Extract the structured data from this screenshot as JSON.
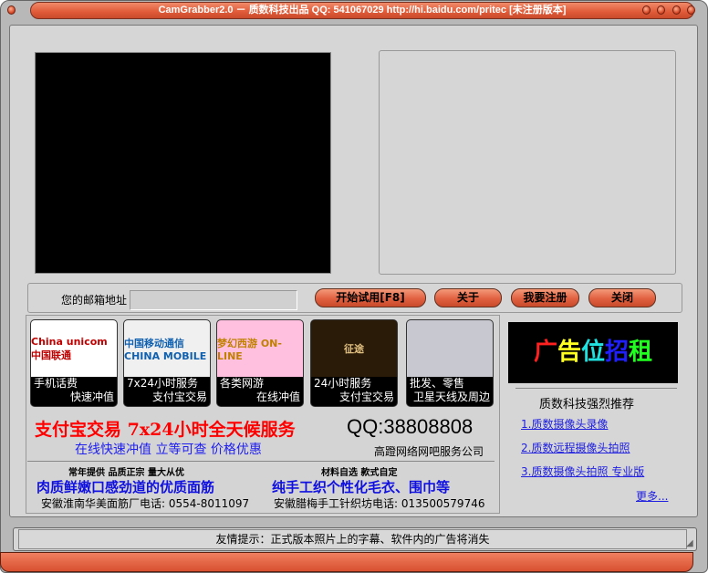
{
  "title": "CamGrabber2.0 －  质数科技出品 QQ: 541067029 http://hi.baidu.com/pritec [未注册版本]",
  "form": {
    "email_label": "您的邮箱地址",
    "email_value": "",
    "buttons": [
      "开始试用[F8]",
      "关于",
      "我要注册",
      "关闭"
    ]
  },
  "tiles": [
    {
      "img": "China unicom 中国联通",
      "l1": "手机话费",
      "l2": "快速冲值",
      "bg": "#ffffff",
      "fg": "#c00000"
    },
    {
      "img": "中国移动通信 CHINA MOBILE",
      "l1": "7x24小时服务",
      "l2": "支付宝交易",
      "bg": "#f0f0f0",
      "fg": "#1060b0"
    },
    {
      "img": "梦幻西游 ON-LINE",
      "l1": "各类网游",
      "l2": "在线冲值",
      "bg": "#ffc0e0",
      "fg": "#c08000"
    },
    {
      "img": "征途",
      "l1": "24小时服务",
      "l2": "支付宝交易",
      "bg": "#2a1a08",
      "fg": "#e0c080"
    },
    {
      "img": "",
      "l1": "批发、零售",
      "l2": "卫星天线及周边",
      "bg": "#c8c8d0",
      "fg": "#c00000"
    }
  ],
  "ad": {
    "headline": "支付宝交易 7x24小时全天候服务",
    "qq": "QQ:38808808",
    "sub": "在线快速冲值 立等可查 价格优惠",
    "company": "高蹬网络网吧服务公司",
    "left": {
      "small": "常年提供 品质正宗 量大从优",
      "big": "肉质鲜嫩口感劲道的优质面筋",
      "contact": "安徽淮南华美面筋厂电话: 0554-8011097"
    },
    "right": {
      "small": "材料自选 款式自定",
      "big": "纯手工织个性化毛衣、围巾等",
      "contact": "安徽腊梅手工针织坊电话: 013500579746"
    }
  },
  "side": {
    "banner": [
      "广",
      "告",
      "位",
      "招",
      "租"
    ],
    "banner_colors": [
      "#ff2020",
      "#ffff20",
      "#20e0e0",
      "#2020ff",
      "#20ff20"
    ],
    "heading": "质数科技强烈推荐",
    "links": [
      "1.质数摄像头录像",
      "2.质数远程摄像头拍照",
      "3.质数摄像头拍照 专业版"
    ],
    "more": "更多..."
  },
  "status": "友情提示：正式版本照片上的字幕、软件内的广告将消失"
}
